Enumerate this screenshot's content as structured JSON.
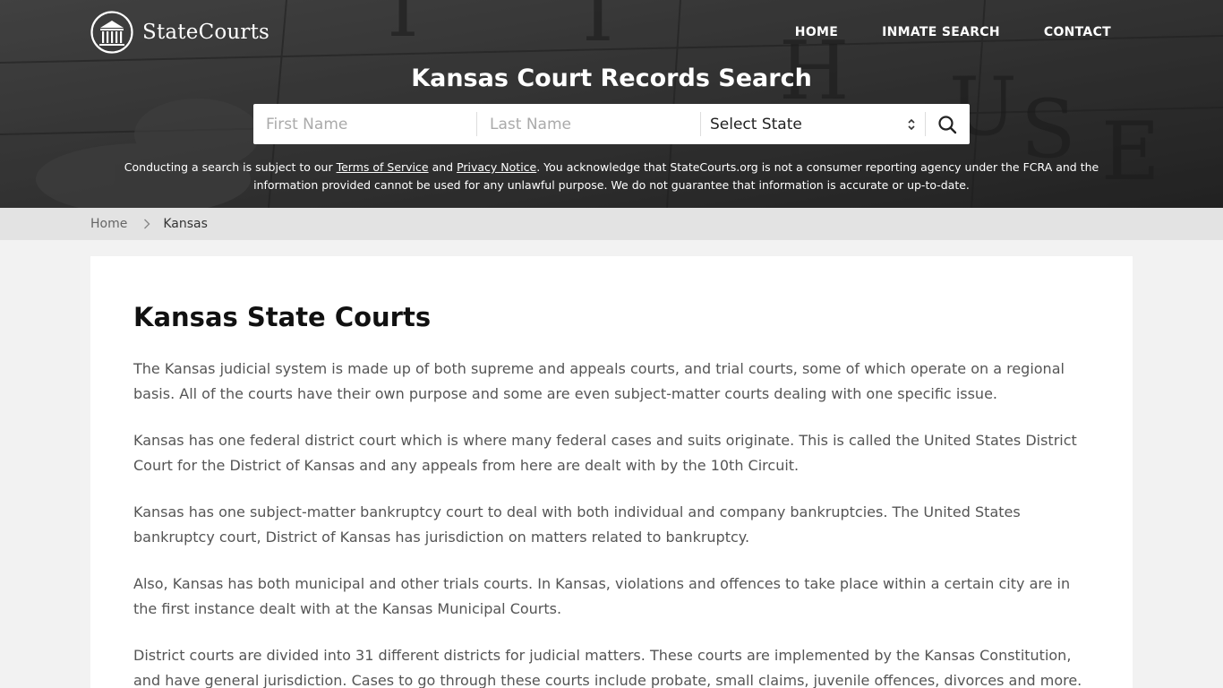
{
  "header": {
    "logo_text": "StateCourts",
    "nav": [
      {
        "label": "HOME"
      },
      {
        "label": "INMATE SEARCH"
      },
      {
        "label": "CONTACT"
      }
    ]
  },
  "hero": {
    "title": "Kansas Court Records Search",
    "search": {
      "first_name_placeholder": "First Name",
      "last_name_placeholder": "Last Name",
      "state_select": "Select State"
    },
    "disclaimer": {
      "part1": "Conducting a search is subject to our ",
      "terms_link": "Terms of Service",
      "part2": " and ",
      "privacy_link": "Privacy Notice",
      "part3": ". You acknowledge that StateCourts.org is not a consumer reporting agency under the FCRA and the information provided cannot be used for any unlawful purpose. We do not guarantee that information is accurate or up-to-date."
    }
  },
  "breadcrumb": {
    "home": "Home",
    "current": "Kansas"
  },
  "content": {
    "title": "Kansas State Courts",
    "paragraphs": [
      "The Kansas judicial system is made up of both supreme and appeals courts, and trial courts, some of which operate on a regional basis. All of the courts have their own purpose and some are even subject-matter courts dealing with one specific issue.",
      "Kansas has one federal district court which is where many federal cases and suits originate. This is called the United States District Court for the District of Kansas and any appeals from here are dealt with by the 10th Circuit.",
      "Kansas has one subject-matter bankruptcy court to deal with both individual and company bankruptcies. The United States bankruptcy court, District of Kansas has jurisdiction on matters related to bankruptcy.",
      "Also, Kansas has both municipal and other trials courts. In Kansas, violations and offences to take place within a certain city are in the first instance dealt with at the Kansas Municipal Courts.",
      "District courts are divided into 31 different districts for judicial matters. These courts are implemented by the Kansas Constitution, and have general jurisdiction. Cases to go through these courts include probate, small claims, juvenile offences, divorces and more."
    ]
  }
}
